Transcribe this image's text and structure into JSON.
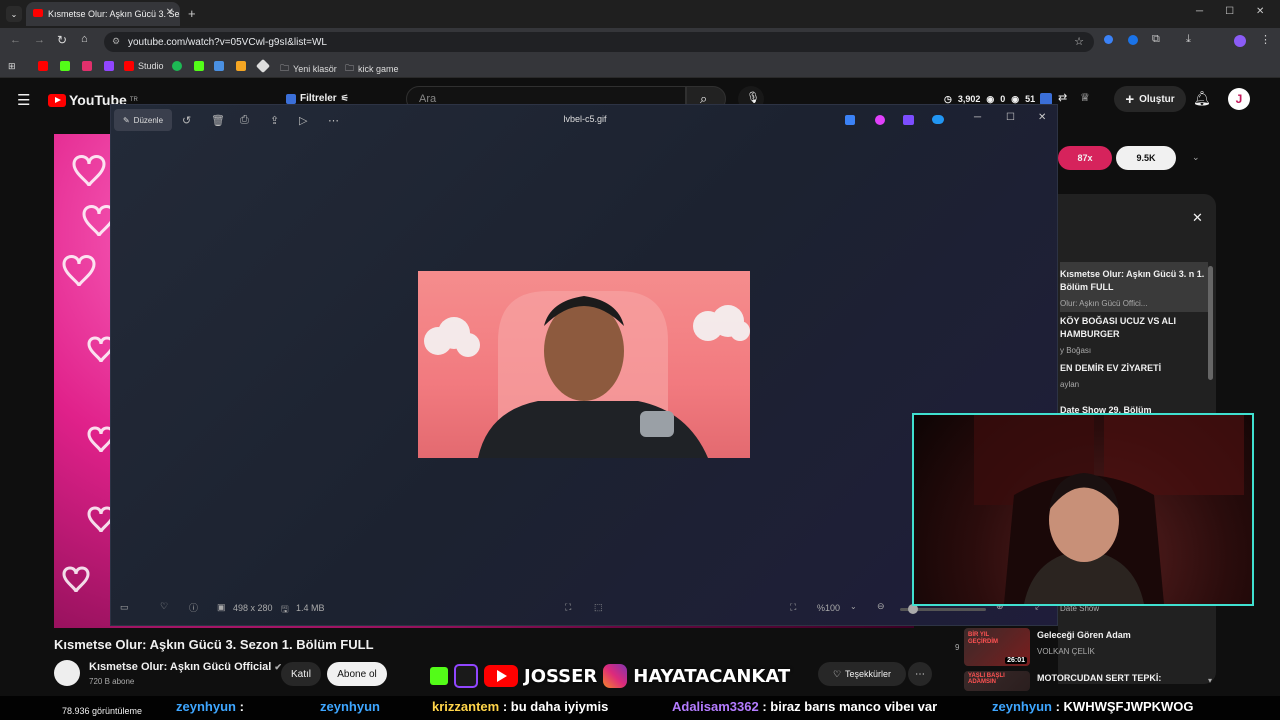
{
  "browser": {
    "tab_title": "Kısmetse Olur: Aşkın Gücü 3. Se",
    "url": "youtube.com/watch?v=05VCwl-g9sI&list=WL",
    "bookmarks": [
      "Studio",
      "Yeni klasör",
      "kick game"
    ]
  },
  "youtube": {
    "logo": "YouTube",
    "region": "TR",
    "filter_label": "Filtreler",
    "search_placeholder": "Ara",
    "stats": {
      "views": "3,902",
      "a": "0",
      "b": "51"
    },
    "create_label": "Oluştur",
    "avatar_letter": "J"
  },
  "viewer": {
    "edit_label": "Düzenle",
    "file_name": "lvbel-c5.gif",
    "dimensions": "498 x 280",
    "file_size": "1.4 MB",
    "zoom": "%100"
  },
  "right_panel": {
    "pill_red": "87x",
    "pill_white": "9.5K",
    "playlist": [
      {
        "title": "Kısmetse Olur: Aşkın Gücü 3. n 1. Bölüm FULL",
        "sub": "Olur: Aşkın Gücü Offici..."
      },
      {
        "title": "KÖY BOĞASI UCUZ VS ALI HAMBURGER",
        "sub": "y Boğası"
      },
      {
        "title": "EN DEMİR EV ZİYARETİ",
        "sub": "aylan"
      },
      {
        "title": "Date Show 29. Bölüm",
        "sub": "Date Show"
      },
      {
        "title": "Geleceği Gören Adam",
        "sub": "VOLKAN ÇELİK",
        "duration": "26:01",
        "index": "9",
        "thumb_text": "BİR YIL GEÇİRDİM"
      },
      {
        "title": "MOTORCUDAN SERT TEPKİ:",
        "sub": "",
        "thumb_text": "YAŞLI BAŞLI ADAMSIN"
      }
    ]
  },
  "video": {
    "title": "Kısmetse Olur: Aşkın Gücü 3. Sezon 1. Bölüm FULL",
    "channel": "Kısmetse Olur: Aşkın Gücü Official",
    "subscribers": "720 B abone",
    "join_label": "Katıl",
    "subscribe_label": "Abone ol",
    "thanks_label": "Teşekkürler",
    "views_line": "78.936 görüntüleme"
  },
  "overlay": {
    "brand1": "JOSSER",
    "brand2": "HAYATACANKAT"
  },
  "chat": [
    {
      "user": "zeynhyun",
      "text": ":",
      "color": "#3ea6ff"
    },
    {
      "user": "zeynhyun",
      "text": "",
      "color": "#3ea6ff"
    },
    {
      "user": "krizzantem",
      "text": ": bu daha iyiymis",
      "color": "#ffd54a"
    },
    {
      "user": "Adalisam3362",
      "text": ": biraz barıs manco vibeı var",
      "color": "#b47cff"
    },
    {
      "user": "zeynhyun",
      "text": ": KWHWŞFJWPKWOG",
      "color": "#3ea6ff"
    }
  ],
  "colors": {
    "accent_red": "#ff0000",
    "webcam_border": "#40e0d0",
    "pill_red": "#d6235c"
  }
}
